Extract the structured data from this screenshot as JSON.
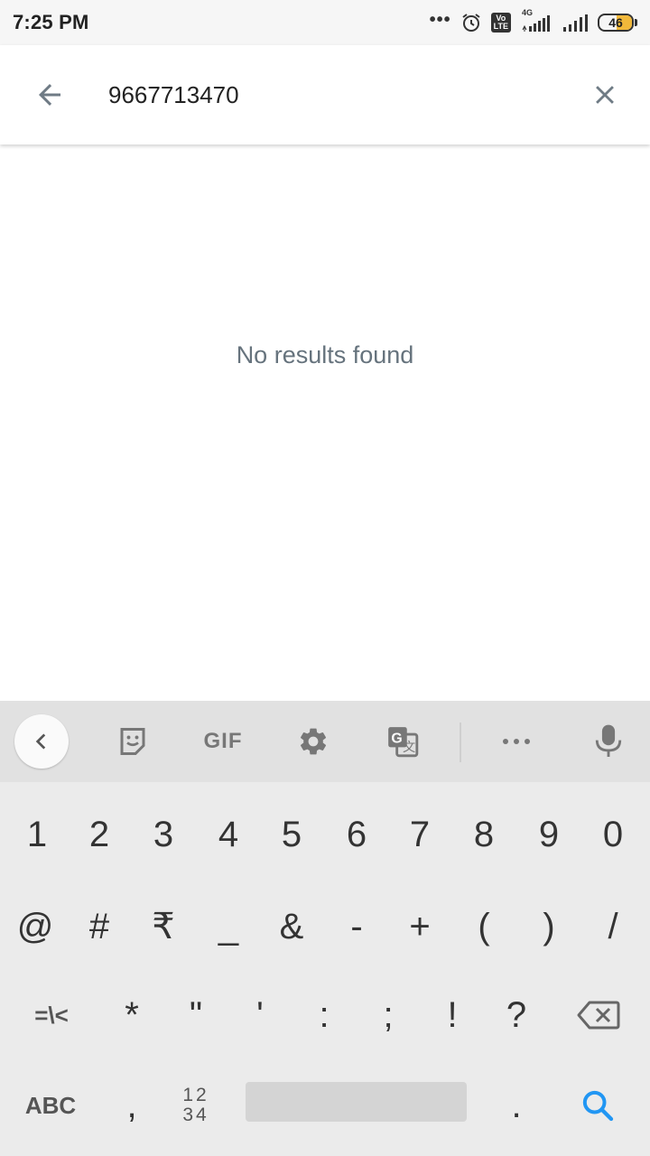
{
  "status_bar": {
    "time": "7:25 PM",
    "network_type": "4G",
    "volte": "Vo LTE",
    "battery_level": "46",
    "icons": [
      "more-dots-icon",
      "alarm-icon",
      "volte-icon",
      "signal-4g-icon",
      "signal-icon",
      "battery-icon"
    ]
  },
  "search": {
    "value": "9667713470",
    "placeholder": ""
  },
  "results": {
    "empty_message": "No results found"
  },
  "keyboard": {
    "toolbar": {
      "gif_label": "GIF",
      "icons": [
        "chevron-left-icon",
        "sticker-icon",
        "gif-icon",
        "gear-icon",
        "translate-icon",
        "more-icon",
        "microphone-icon"
      ]
    },
    "row1": [
      "1",
      "2",
      "3",
      "4",
      "5",
      "6",
      "7",
      "8",
      "9",
      "0"
    ],
    "row2": [
      "@",
      "#",
      "₹",
      "_",
      "&",
      "-",
      "+",
      "(",
      ")",
      "/"
    ],
    "row3": [
      "=\\<",
      "*",
      "\"",
      "'",
      ":",
      ";",
      "!",
      "?"
    ],
    "row4": {
      "abc_label": "ABC",
      "comma": ",",
      "numpad_top": "12",
      "numpad_bottom": "34",
      "period": "."
    },
    "accent_color": "#2196f3"
  }
}
